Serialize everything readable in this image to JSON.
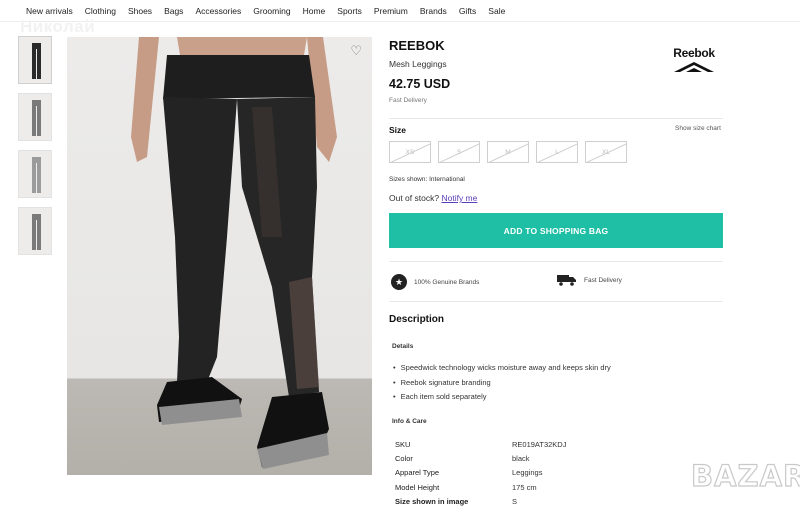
{
  "nav": {
    "items": [
      "New arrivals",
      "Clothing",
      "Shoes",
      "Bags",
      "Accessories",
      "Grooming",
      "Home",
      "Sports",
      "Premium",
      "Brands",
      "Gifts",
      "Sale"
    ]
  },
  "watermark_user": "Николай",
  "gallery": {
    "wishlist_icon": "heart-outline-icon",
    "thumbnails": 4
  },
  "product": {
    "brand": "REEBOK",
    "name": "Mesh Leggings",
    "price": "42.75 USD",
    "delivery_note": "Fast Delivery",
    "brand_logo": "Reebok"
  },
  "size": {
    "label": "Size",
    "chart_link": "Show size chart",
    "options": [
      "XS",
      "S",
      "M",
      "L",
      "XL"
    ],
    "sizes_shown": "Sizes shown: International",
    "out_of_stock": "Out of stock?",
    "notify": "Notify me"
  },
  "cart": {
    "add_label": "ADD TO SHOPPING BAG"
  },
  "features": {
    "genuine": "100% Genuine Brands",
    "fast": "Fast Delivery"
  },
  "description": {
    "title": "Description",
    "details_title": "Details",
    "bullets": [
      "Speedwick technology wicks moisture away and keeps skin dry",
      "Reebok signature branding",
      "Each item sold separately"
    ],
    "info_title": "Info & Care",
    "specs": [
      {
        "key": "SKU",
        "value": "RE019AT32KDJ"
      },
      {
        "key": "Color",
        "value": "black"
      },
      {
        "key": "Apparel Type",
        "value": "Leggings"
      },
      {
        "key": "Model Height",
        "value": "175 cm"
      },
      {
        "key": "Size shown in image",
        "value": "S"
      }
    ]
  },
  "watermark": "BAZAR",
  "colors": {
    "accent": "#1fbfa6",
    "link": "#5a3fb7"
  }
}
